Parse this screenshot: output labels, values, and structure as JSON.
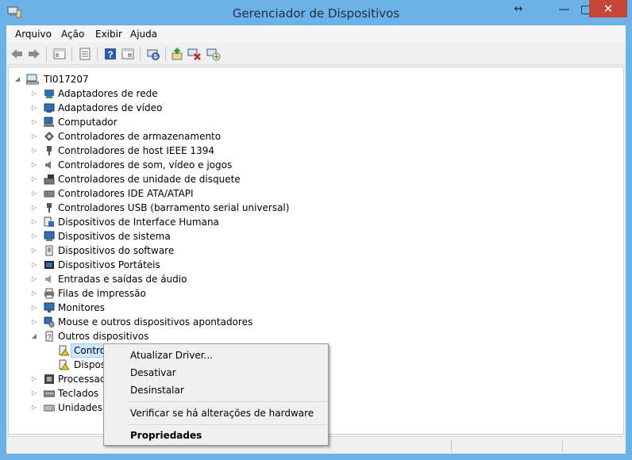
{
  "window": {
    "title": "Gerenciador de Dispositivos",
    "move_glyph": "↔",
    "minimize_glyph": "—",
    "maximize_glyph": "□",
    "close_glyph": "✕"
  },
  "menubar": {
    "items": [
      "Arquivo",
      "Ação",
      "Exibir",
      "Ajuda"
    ]
  },
  "toolbar": {
    "buttons": [
      "back-arrow-icon",
      "forward-arrow-icon",
      "console-tree-icon",
      "properties-icon",
      "help-icon",
      "details-view-icon",
      "scan-hardware-icon",
      "update-driver-icon",
      "uninstall-device-icon",
      "add-legacy-hardware-icon"
    ]
  },
  "tree": {
    "root": "TI017207",
    "categories": [
      {
        "label": "Adaptadores de rede",
        "icon": "network-adapter-icon",
        "expanded": false
      },
      {
        "label": "Adaptadores de vídeo",
        "icon": "display-adapter-icon",
        "expanded": false
      },
      {
        "label": "Computador",
        "icon": "computer-icon",
        "expanded": false
      },
      {
        "label": "Controladores de armazenamento",
        "icon": "storage-controller-icon",
        "expanded": false
      },
      {
        "label": "Controladores de host IEEE 1394",
        "icon": "ieee1394-icon",
        "expanded": false
      },
      {
        "label": "Controladores de som, vídeo e jogos",
        "icon": "speaker-icon",
        "expanded": false
      },
      {
        "label": "Controladores de unidade de disquete",
        "icon": "floppy-controller-icon",
        "expanded": false
      },
      {
        "label": "Controladores IDE ATA/ATAPI",
        "icon": "ide-controller-icon",
        "expanded": false
      },
      {
        "label": "Controladores USB (barramento serial universal)",
        "icon": "usb-icon",
        "expanded": false
      },
      {
        "label": "Dispositivos de Interface Humana",
        "icon": "hid-icon",
        "expanded": false
      },
      {
        "label": "Dispositivos de sistema",
        "icon": "system-device-icon",
        "expanded": false
      },
      {
        "label": "Dispositivos do software",
        "icon": "software-device-icon",
        "expanded": false
      },
      {
        "label": "Dispositivos Portáteis",
        "icon": "portable-device-icon",
        "expanded": false
      },
      {
        "label": "Entradas e saídas de áudio",
        "icon": "audio-io-icon",
        "expanded": false
      },
      {
        "label": "Filas de impressão",
        "icon": "printer-icon",
        "expanded": false
      },
      {
        "label": "Monitores",
        "icon": "monitor-icon",
        "expanded": false
      },
      {
        "label": "Mouse e outros dispositivos apontadores",
        "icon": "mouse-icon",
        "expanded": false
      },
      {
        "label": "Outros dispositivos",
        "icon": "unknown-device-icon",
        "expanded": true
      }
    ],
    "other_children": [
      {
        "label": "Contro",
        "icon": "warning-device-icon",
        "selected": true
      },
      {
        "label": "Disposi",
        "icon": "warning-device-icon",
        "selected": false
      }
    ],
    "trailing_categories": [
      {
        "label": "Processad",
        "icon": "processor-icon",
        "expanded": false
      },
      {
        "label": "Teclados",
        "icon": "keyboard-icon",
        "expanded": false
      },
      {
        "label": "Unidades d",
        "icon": "disk-drive-icon",
        "expanded": false
      }
    ],
    "collapsed_glyph": "▷",
    "expanded_glyph": "◢"
  },
  "context_menu": {
    "items": [
      {
        "label": "Atualizar Driver...",
        "bold": false
      },
      {
        "label": "Desativar",
        "bold": false
      },
      {
        "label": "Desinstalar",
        "bold": false
      },
      {
        "label": "Verificar se há alterações de hardware",
        "bold": false
      },
      {
        "label": "Propriedades",
        "bold": true
      }
    ]
  },
  "colors": {
    "frame": "#6bb3e6",
    "close": "#c7463a",
    "selection": "#cce8ff"
  }
}
